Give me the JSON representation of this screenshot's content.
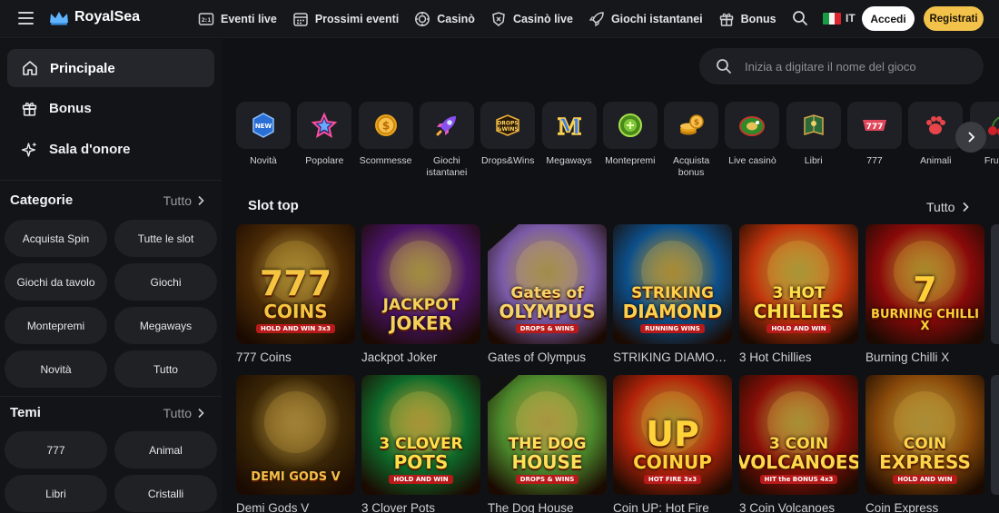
{
  "brand": {
    "name": "RoyalSea"
  },
  "nav": [
    {
      "label": "Eventi live",
      "icon": "live-events-icon"
    },
    {
      "label": "Prossimi eventi",
      "icon": "calendar-icon"
    },
    {
      "label": "Casinò",
      "icon": "casino-chip-icon"
    },
    {
      "label": "Casinò live",
      "icon": "live-casino-icon"
    },
    {
      "label": "Giochi istantanei",
      "icon": "rocket-icon"
    },
    {
      "label": "Bonus",
      "icon": "gift-icon"
    }
  ],
  "header": {
    "lang": "IT",
    "login": "Accedi",
    "register": "Registrati"
  },
  "sidebar": {
    "main": [
      {
        "label": "Principale",
        "icon": "home-icon"
      },
      {
        "label": "Bonus",
        "icon": "gift-icon"
      },
      {
        "label": "Sala d'onore",
        "icon": "sparkle-icon"
      }
    ],
    "categories": {
      "title": "Categorie",
      "all": "Tutto",
      "items": [
        "Acquista Spin",
        "Tutte le slot",
        "Giochi da tavolo",
        "Giochi",
        "Montepremi",
        "Megaways",
        "Novità",
        "Tutto"
      ]
    },
    "themes": {
      "title": "Temi",
      "all": "Tutto",
      "items": [
        "777",
        "Animal",
        "Libri",
        "Cristalli"
      ]
    }
  },
  "search": {
    "placeholder": "Inizia a digitare il nome del gioco"
  },
  "categories": [
    {
      "label": "Novità",
      "icon": "new-badge-icon"
    },
    {
      "label": "Popolare",
      "icon": "star-icon"
    },
    {
      "label": "Scommesse",
      "icon": "coin-icon"
    },
    {
      "label": "Giochi istantanei",
      "icon": "rocket-icon"
    },
    {
      "label": "Drops&Wins",
      "icon": "drops-wins-icon"
    },
    {
      "label": "Megaways",
      "icon": "megaways-icon"
    },
    {
      "label": "Montepremi",
      "icon": "jackpot-icon"
    },
    {
      "label": "Acquista bonus",
      "icon": "coin-stack-icon"
    },
    {
      "label": "Live casinò",
      "icon": "roulette-icon"
    },
    {
      "label": "Libri",
      "icon": "book-icon"
    },
    {
      "label": "777",
      "icon": "ribbon-777-icon"
    },
    {
      "label": "Animali",
      "icon": "paw-icon"
    },
    {
      "label": "Frutta",
      "icon": "cherry-icon"
    }
  ],
  "slots": {
    "title": "Slot top",
    "all": "Tutto",
    "games": [
      {
        "name": "777 Coins",
        "art": "777",
        "art2": "COINS",
        "badge": "HOLD AND WIN 3x3",
        "bg": "#4a2a06",
        "fg": "#f5c542"
      },
      {
        "name": "Jackpot Joker",
        "art": "JACKPOT",
        "art2": "JOKER",
        "badge": "",
        "bg": "#4a1466",
        "fg": "#f3d35a"
      },
      {
        "name": "Gates of Olympus",
        "art": "Gates of",
        "art2": "OLYMPUS",
        "badge": "DROPS & WINS",
        "bg": "#7a5aa8",
        "fg": "#f5d46a"
      },
      {
        "name": "STRIKING DIAMOND",
        "art": "STRIKING",
        "art2": "DIAMOND",
        "badge": "RUNNING WINS",
        "bg": "#0c4f8a",
        "fg": "#ffd04a"
      },
      {
        "name": "3 Hot Chillies",
        "art": "3 HOT",
        "art2": "CHILLIES",
        "badge": "HOLD AND WIN",
        "bg": "#c0330c",
        "fg": "#ffe14a"
      },
      {
        "name": "Burning Chilli X",
        "art": "7",
        "art2": "BURNING CHILLI X",
        "badge": "",
        "bg": "#8a0a0a",
        "fg": "#ffcf3a"
      },
      {
        "name": "Demi Gods V",
        "art": "",
        "art2": "DEMI GODS V",
        "badge": "",
        "bg": "#3a2606",
        "fg": "#f2c04a"
      },
      {
        "name": "3 Clover Pots",
        "art": "3 CLOVER",
        "art2": "POTS",
        "badge": "HOLD AND WIN",
        "bg": "#0f6a2a",
        "fg": "#ffe04a"
      },
      {
        "name": "The Dog House",
        "art": "THE DOG",
        "art2": "HOUSE",
        "badge": "DROPS & WINS",
        "bg": "#4c8a2c",
        "fg": "#ffe05a"
      },
      {
        "name": "Coin UP: Hot Fire",
        "art": "UP",
        "art2": "COINUP",
        "badge": "HOT FIRE 3x3",
        "bg": "#b2230a",
        "fg": "#ffd23a"
      },
      {
        "name": "3 Coin Volcanoes",
        "art": "3 COIN",
        "art2": "VOLCANOES",
        "badge": "HIT the BONUS 4x3",
        "bg": "#8a1008",
        "fg": "#ffd84a"
      },
      {
        "name": "Coin Express",
        "art": "COIN",
        "art2": "EXPRESS",
        "badge": "HOLD AND WIN",
        "bg": "#8a4a0a",
        "fg": "#ffd44a"
      }
    ]
  }
}
